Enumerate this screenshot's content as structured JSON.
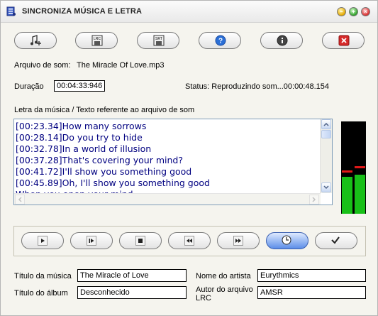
{
  "window": {
    "title": "SINCRONIZA MÚSICA E LETRA"
  },
  "toolbar": {
    "icons": [
      "add-music-icon",
      "save-lrc-icon",
      "save-srt-icon",
      "help-icon",
      "info-icon",
      "exit-icon"
    ],
    "lrc_label": "LRC",
    "srt_label": "SRT"
  },
  "file": {
    "label": "Arquivo de som:",
    "value": "The Miracle Of Love.mp3"
  },
  "duration": {
    "label": "Duração",
    "value": "00:04:33:946"
  },
  "status": {
    "text": "Status: Reproduzindo som...00:00:48.154"
  },
  "lyrics_label": "Letra da música / Texto referente ao arquivo de som",
  "lyrics": [
    "[00:23.34]How many sorrows",
    "[00:28.14]Do you try to hide",
    "[00:32.78]In a world of illusion",
    "[00:37.28]That's covering your mind?",
    "[00:41.72]I'll show you something good",
    "[00:45.89]Oh, I'll show you something good",
    "When you open your mind"
  ],
  "vu_meter": {
    "left_level": 0.4,
    "right_level": 0.42,
    "left_peak": 0.45,
    "right_peak": 0.49
  },
  "transport": {
    "icons": [
      "play-icon",
      "pause-icon",
      "stop-icon",
      "rewind-icon",
      "fast-forward-icon",
      "clock-icon",
      "checkmark-icon"
    ],
    "active": "clock-icon"
  },
  "meta": {
    "song_title_label": "Título da música",
    "song_title": "The Miracle of Love",
    "artist_label": "Nome do  artista",
    "artist": "Eurythmics",
    "album_label": "Título do  álbum",
    "album": "Desconhecido",
    "lrc_author_label": "Autor do arquivo LRC",
    "lrc_author": "AMSR"
  }
}
